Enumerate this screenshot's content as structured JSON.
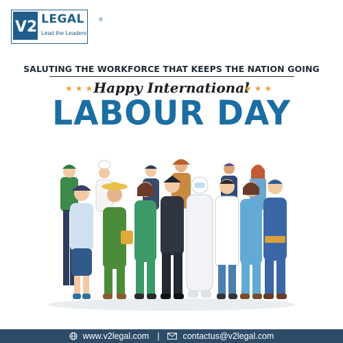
{
  "logo": {
    "mark_text": "V2",
    "word": "LEGAL",
    "tagline": "Lead the Leaders",
    "registered": "®"
  },
  "headline": {
    "tagline": "SALUTING THE WORKFORCE THAT KEEPS THE NATION GOING",
    "stars": "★★★",
    "greeting": "Happy International",
    "title": "LABOUR DAY"
  },
  "footer": {
    "website": "www.v2legal.com",
    "separator": "|",
    "email": "contactus@v2legal.com"
  },
  "colors": {
    "brand_blue": "#1f5e8c",
    "title_blue": "#1a6ea2",
    "star_orange": "#e8a23a",
    "footer_bg": "#2d4c67"
  },
  "icons": [
    "globe-icon",
    "mail-icon",
    "star-icon"
  ]
}
